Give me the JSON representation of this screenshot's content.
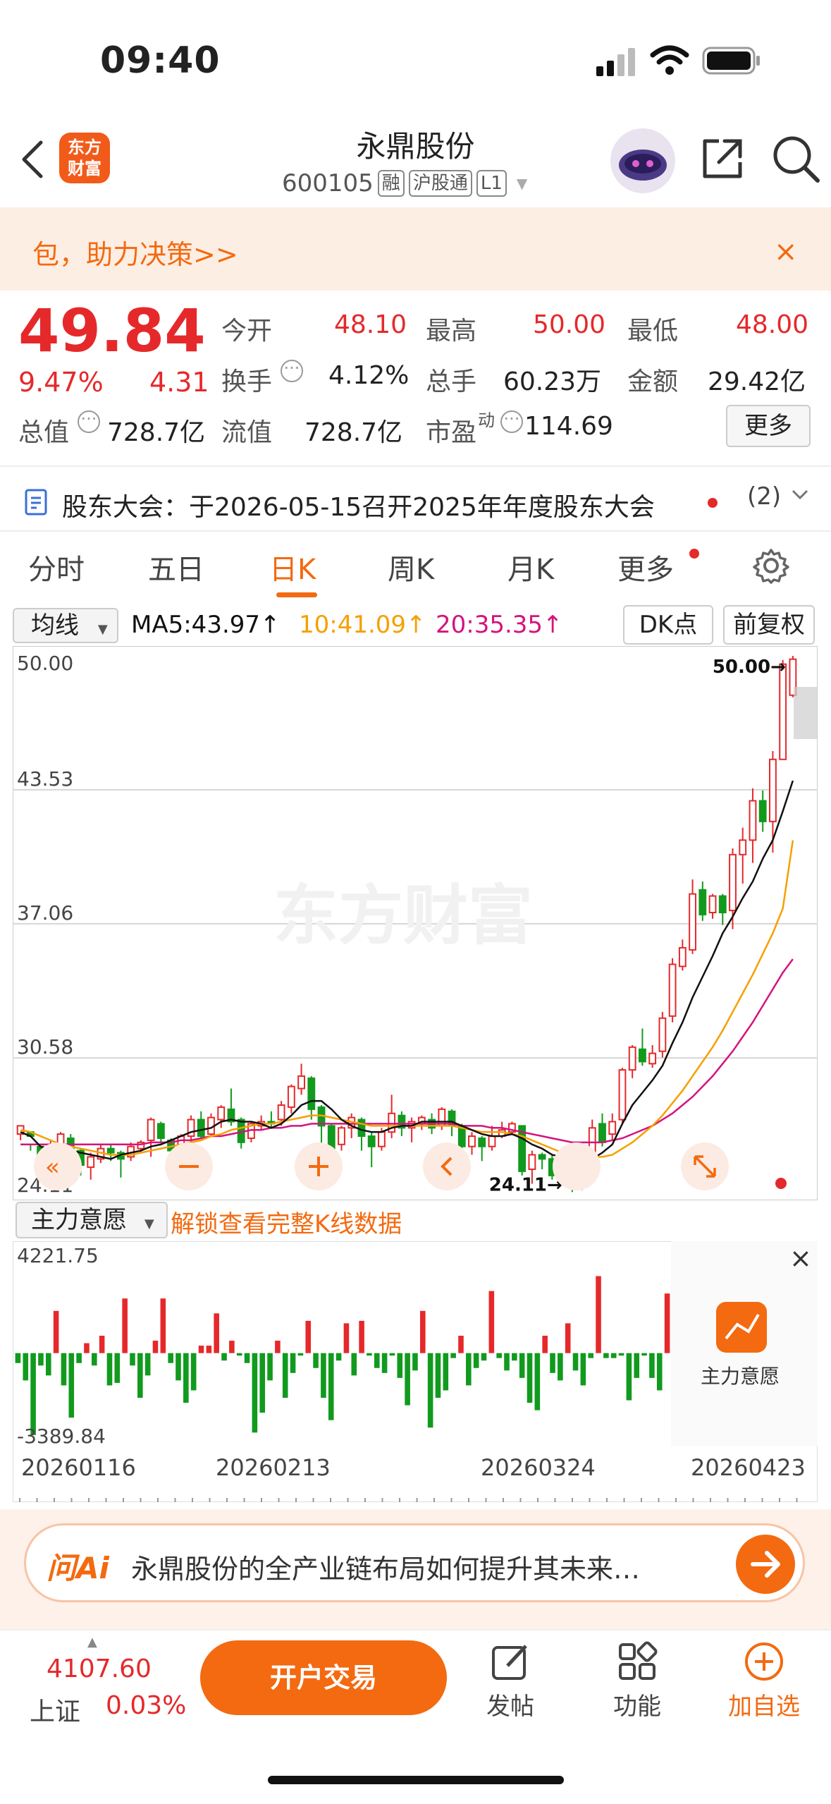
{
  "status_bar": {
    "time": "09:40"
  },
  "header": {
    "logo_text_line1": "东方",
    "logo_text_line2": "财富",
    "stock_name": "永鼎股份",
    "stock_code": "600105",
    "tags": [
      "融",
      "沪股通",
      "L1"
    ]
  },
  "banner": {
    "text": "包，助力决策>>",
    "close": "×"
  },
  "quote": {
    "price": "49.84",
    "change_pct": "9.47%",
    "change_amt": "4.31",
    "open_label": "今开",
    "open": "48.10",
    "high_label": "最高",
    "high": "50.00",
    "low_label": "最低",
    "low": "48.00",
    "turnover_label": "换手",
    "turnover": "4.12%",
    "volume_label": "总手",
    "volume": "60.23万",
    "amount_label": "金额",
    "amount": "29.42亿",
    "mktcap_label": "总值",
    "mktcap": "728.7亿",
    "float_label": "流值",
    "float": "728.7亿",
    "pe_label": "市盈",
    "pe_sup": "动",
    "pe": "114.69",
    "more_button": "更多"
  },
  "notice": {
    "text": "股东大会：于2026-05-15召开2025年年度股东大会",
    "count": "(2)"
  },
  "tabs": [
    "分时",
    "五日",
    "日K",
    "周K",
    "月K",
    "更多"
  ],
  "ma": {
    "selector": "均线",
    "ma5": "MA5:43.97↑",
    "ma10": "10:41.09↑",
    "ma20": "20:35.35↑",
    "dk_button": "DK点",
    "adjust_button": "前复权",
    "colors": {
      "ma5": "#111111",
      "ma10": "#f5a000",
      "ma20": "#d4147e",
      "up": "#e5292b",
      "down": "#119a1e",
      "accent": "#f36a10"
    }
  },
  "chart_data": [
    {
      "type": "candlestick",
      "title": "",
      "y_ticks": [
        "50.00",
        "43.53",
        "37.06",
        "30.58",
        "24.11"
      ],
      "ylim": [
        24.11,
        50.0
      ],
      "max_label": "50.00→",
      "min_label": "24.11→",
      "watermark": "东方财富",
      "candles": [
        [
          26.9,
          27.3,
          26.6,
          27.0
        ],
        [
          27.0,
          26.8,
          26.4,
          26.1
        ],
        [
          26.3,
          25.4,
          25.2,
          24.6
        ],
        [
          25.3,
          26.3,
          24.9,
          26.6
        ],
        [
          26.1,
          26.9,
          25.7,
          27.0
        ],
        [
          26.7,
          26.1,
          25.6,
          26.9
        ],
        [
          26.1,
          25.4,
          24.9,
          26.2
        ],
        [
          25.3,
          25.8,
          24.7,
          26.0
        ],
        [
          25.7,
          26.2,
          25.5,
          26.4
        ],
        [
          26.2,
          26.0,
          25.6,
          26.4
        ],
        [
          26.0,
          25.7,
          24.8,
          26.1
        ],
        [
          25.8,
          26.3,
          25.6,
          26.5
        ],
        [
          26.2,
          26.5,
          26.0,
          26.6
        ],
        [
          26.6,
          27.6,
          25.8,
          27.7
        ],
        [
          27.4,
          26.7,
          26.5,
          27.5
        ],
        [
          26.6,
          26.1,
          25.9,
          26.7
        ],
        [
          26.3,
          26.8,
          26.2,
          26.9
        ],
        [
          26.8,
          27.6,
          26.5,
          27.8
        ],
        [
          27.6,
          26.8,
          26.7,
          28.0
        ],
        [
          26.9,
          27.7,
          26.8,
          27.9
        ],
        [
          27.6,
          28.2,
          27.2,
          28.3
        ],
        [
          28.1,
          27.5,
          27.3,
          29.1
        ],
        [
          27.6,
          26.5,
          26.2,
          27.7
        ],
        [
          26.7,
          27.4,
          26.5,
          27.5
        ],
        [
          27.3,
          27.5,
          27.1,
          27.8
        ],
        [
          27.5,
          27.4,
          27.2,
          28.0
        ],
        [
          27.6,
          28.3,
          27.3,
          28.5
        ],
        [
          28.2,
          29.2,
          27.9,
          29.3
        ],
        [
          29.1,
          29.7,
          28.8,
          30.3
        ],
        [
          29.6,
          28.1,
          27.6,
          29.7
        ],
        [
          28.2,
          27.3,
          26.2,
          28.3
        ],
        [
          27.3,
          26.2,
          25.2,
          27.4
        ],
        [
          26.4,
          27.2,
          26.1,
          27.3
        ],
        [
          27.2,
          27.7,
          26.7,
          27.9
        ],
        [
          27.6,
          26.8,
          26.1,
          27.7
        ],
        [
          26.8,
          26.3,
          25.3,
          27.0
        ],
        [
          26.3,
          27.0,
          26.1,
          27.2
        ],
        [
          27.0,
          27.9,
          26.7,
          28.8
        ],
        [
          27.8,
          27.2,
          26.8,
          28.0
        ],
        [
          27.2,
          27.5,
          26.5,
          27.7
        ],
        [
          27.4,
          27.7,
          27.1,
          27.8
        ],
        [
          27.6,
          27.2,
          26.9,
          27.9
        ],
        [
          27.3,
          28.1,
          27.1,
          28.2
        ],
        [
          28.0,
          27.3,
          26.8,
          28.1
        ],
        [
          27.3,
          26.3,
          25.8,
          27.4
        ],
        [
          26.3,
          26.8,
          25.9,
          27.0
        ],
        [
          26.7,
          26.3,
          25.6,
          26.8
        ],
        [
          26.3,
          26.8,
          26.1,
          27.3
        ],
        [
          26.8,
          27.1,
          26.7,
          27.5
        ],
        [
          27.0,
          27.4,
          26.9,
          27.5
        ],
        [
          27.3,
          25.1,
          24.9,
          25.4
        ],
        [
          25.2,
          25.9,
          24.5,
          26.1
        ],
        [
          25.9,
          25.7,
          25.2,
          26.0
        ],
        [
          25.7,
          24.9,
          24.7,
          25.9
        ],
        [
          25.1,
          25.6,
          24.7,
          25.8
        ],
        [
          25.4,
          24.6,
          24.1,
          25.6
        ],
        [
          24.7,
          25.6,
          24.2,
          25.8
        ],
        [
          25.6,
          27.2,
          25.4,
          27.6
        ],
        [
          27.4,
          26.5,
          26.3,
          27.9
        ],
        [
          26.9,
          27.5,
          26.6,
          27.9
        ],
        [
          27.6,
          30.0,
          27.4,
          30.1
        ],
        [
          30.0,
          31.1,
          29.6,
          31.2
        ],
        [
          31.0,
          30.4,
          30.2,
          32.0
        ],
        [
          30.3,
          30.8,
          30.1,
          31.2
        ],
        [
          30.9,
          32.5,
          30.6,
          32.8
        ],
        [
          32.6,
          35.1,
          32.3,
          35.4
        ],
        [
          35.0,
          35.9,
          34.8,
          36.3
        ],
        [
          35.8,
          38.5,
          35.6,
          39.2
        ],
        [
          38.7,
          37.5,
          37.2,
          39.1
        ],
        [
          37.6,
          38.4,
          37.3,
          38.5
        ],
        [
          38.4,
          37.6,
          37.0,
          38.5
        ],
        [
          37.7,
          40.4,
          36.8,
          40.7
        ],
        [
          40.4,
          41.1,
          39.0,
          41.7
        ],
        [
          41.1,
          43.0,
          40.0,
          43.6
        ],
        [
          43.0,
          42.0,
          41.5,
          43.5
        ],
        [
          42.0,
          45.0,
          40.5,
          45.4
        ],
        [
          45.0,
          49.6,
          45.0,
          49.8
        ],
        [
          48.1,
          49.84,
          48.0,
          50.0
        ]
      ],
      "ma5": [
        27.0,
        26.8,
        26.3,
        26.1,
        26.0,
        26.1,
        26.0,
        25.9,
        25.8,
        25.7,
        25.9,
        26.0,
        26.1,
        26.3,
        26.4,
        26.6,
        26.8,
        27.0,
        27.1,
        27.2,
        27.5,
        27.6,
        27.5,
        27.5,
        27.4,
        27.2,
        27.4,
        27.8,
        28.3,
        28.5,
        28.5,
        28.1,
        27.6,
        27.3,
        27.1,
        27.0,
        27.0,
        27.2,
        27.3,
        27.3,
        27.5,
        27.5,
        27.5,
        27.5,
        27.3,
        27.1,
        26.9,
        26.8,
        26.8,
        26.9,
        26.7,
        26.4,
        26.2,
        25.9,
        25.8,
        25.6,
        25.3,
        25.7,
        26.0,
        26.4,
        27.4,
        28.3,
        28.9,
        29.5,
        30.2,
        31.3,
        32.3,
        33.5,
        34.5,
        35.5,
        36.6,
        37.4,
        38.3,
        39.1,
        40.2,
        41.1,
        42.5,
        43.97
      ],
      "ma10": [
        27.1,
        27.0,
        26.8,
        26.6,
        26.4,
        26.3,
        26.2,
        26.1,
        26.0,
        25.9,
        25.9,
        25.9,
        26.0,
        26.1,
        26.2,
        26.3,
        26.4,
        26.5,
        26.6,
        26.8,
        26.9,
        27.1,
        27.2,
        27.3,
        27.4,
        27.4,
        27.5,
        27.6,
        27.7,
        27.8,
        27.8,
        27.7,
        27.6,
        27.5,
        27.4,
        27.3,
        27.3,
        27.3,
        27.3,
        27.3,
        27.3,
        27.3,
        27.3,
        27.3,
        27.2,
        27.1,
        27.0,
        27.0,
        27.0,
        26.9,
        26.8,
        26.6,
        26.4,
        26.2,
        26.0,
        25.9,
        25.8,
        25.8,
        25.8,
        25.9,
        26.2,
        26.5,
        26.9,
        27.3,
        27.8,
        28.4,
        29.0,
        29.7,
        30.4,
        31.1,
        31.9,
        32.8,
        33.7,
        34.6,
        35.6,
        36.6,
        37.8,
        41.09
      ],
      "ma20": [
        26.4,
        26.4,
        26.4,
        26.4,
        26.4,
        26.4,
        26.4,
        26.4,
        26.4,
        26.4,
        26.4,
        26.4,
        26.4,
        26.5,
        26.5,
        26.5,
        26.6,
        26.6,
        26.7,
        26.8,
        26.8,
        26.9,
        27.0,
        27.1,
        27.1,
        27.2,
        27.2,
        27.3,
        27.3,
        27.4,
        27.4,
        27.4,
        27.4,
        27.4,
        27.4,
        27.4,
        27.4,
        27.4,
        27.4,
        27.4,
        27.4,
        27.4,
        27.4,
        27.4,
        27.3,
        27.3,
        27.3,
        27.2,
        27.2,
        27.1,
        27.0,
        26.9,
        26.8,
        26.7,
        26.6,
        26.5,
        26.5,
        26.5,
        26.5,
        26.6,
        26.7,
        26.9,
        27.1,
        27.3,
        27.6,
        27.9,
        28.3,
        28.7,
        29.2,
        29.7,
        30.3,
        30.9,
        31.6,
        32.3,
        33.1,
        33.9,
        34.7,
        35.35
      ]
    },
    {
      "type": "bar",
      "title": "",
      "indicator_selector": "主力意愿",
      "unlock_text": "解锁查看完整K线数据",
      "ymax_label": "4221.75",
      "ymin_label": "-3389.84",
      "ylim": [
        -3389.84,
        4221.75
      ],
      "x_labels": [
        "20260116",
        "20260213",
        "20260324",
        "20260423"
      ],
      "values": [
        -400,
        -1100,
        -3300,
        -500,
        -900,
        1700,
        -1300,
        -2600,
        -400,
        400,
        -500,
        700,
        -1300,
        -1200,
        2200,
        -500,
        -1800,
        -900,
        500,
        2200,
        -400,
        -1100,
        -2000,
        -1500,
        300,
        300,
        1600,
        -300,
        500,
        -100,
        -400,
        -3200,
        -2400,
        -1100,
        500,
        -1800,
        -800,
        -100,
        1300,
        -600,
        -1800,
        -2700,
        -300,
        1200,
        -900,
        1300,
        -100,
        -600,
        -800,
        -100,
        -1000,
        -2100,
        -700,
        1700,
        -3000,
        -1800,
        -1500,
        -200,
        700,
        -1300,
        -600,
        -300,
        2500,
        -200,
        -700,
        -300,
        -1000,
        -2000,
        -2300,
        700,
        -800,
        -1100,
        1200,
        -700,
        -1300,
        -200,
        3100,
        -200,
        -200,
        -100,
        -1900,
        -1000,
        -100,
        -1000,
        -1500,
        2400
      ],
      "panel_label": "主力意愿",
      "close": "×"
    }
  ],
  "ai_bar": {
    "logo": "问Ai",
    "text": "永鼎股份的全产业链布局如何提升其未来…"
  },
  "bottom": {
    "index_value": "4107.60",
    "index_name": "上证",
    "index_change": "0.03%",
    "trade_button": "开户交易",
    "post": "发帖",
    "features": "功能",
    "add_watch": "加自选"
  }
}
